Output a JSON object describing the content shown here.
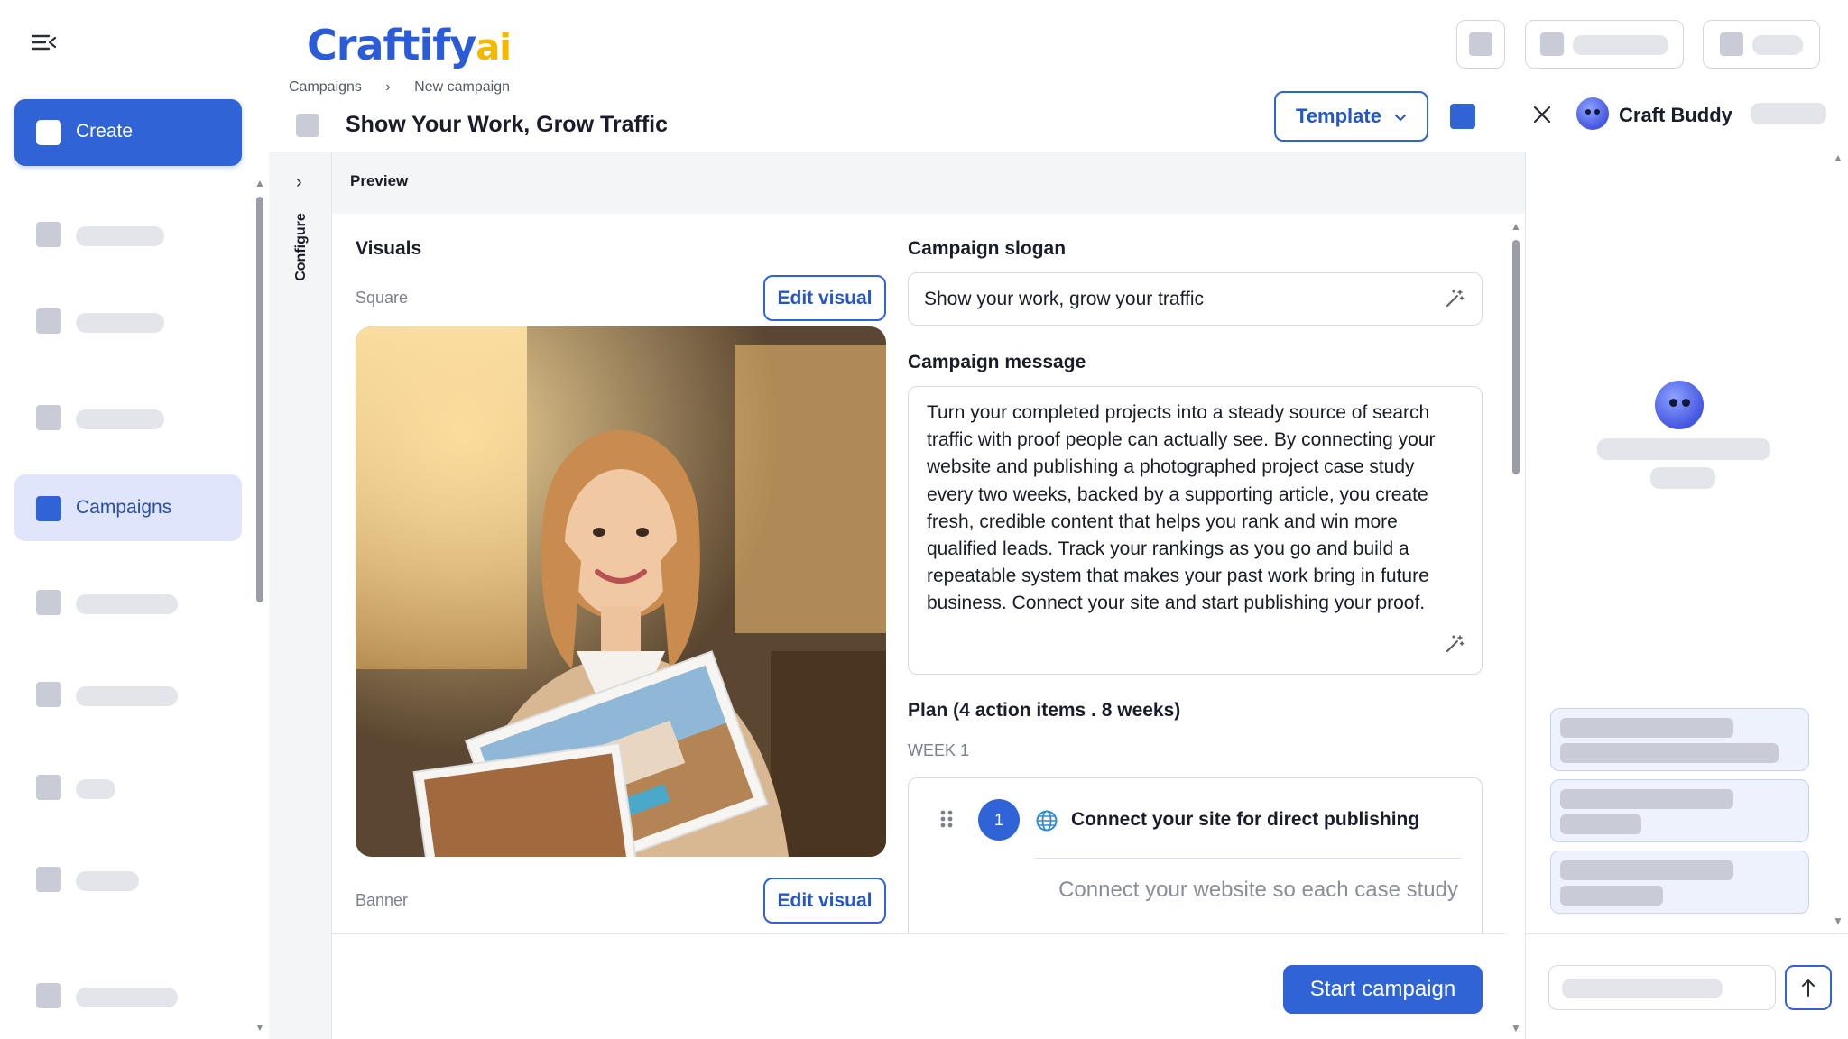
{
  "app": {
    "logo_main": "Craftify",
    "logo_ai": "ai"
  },
  "breadcrumb": {
    "root": "Campaigns",
    "current": "New campaign"
  },
  "page": {
    "title": "Show Your Work, Grow Traffic"
  },
  "sidebar": {
    "create_label": "Create",
    "campaigns_label": "Campaigns"
  },
  "toolbar": {
    "template_label": "Template"
  },
  "configure": {
    "label": "Configure"
  },
  "preview": {
    "title": "Preview",
    "visuals_title": "Visuals",
    "square_label": "Square",
    "banner_label": "Banner",
    "edit_visual_label": "Edit visual",
    "slogan_title": "Campaign slogan",
    "slogan_value": "Show your work, grow your traffic",
    "message_title": "Campaign message",
    "message_value": "Turn your completed projects into a steady source of search traffic with proof people can actually see. By connecting your website and publishing a photographed project case study every two weeks, backed by a supporting article, you create fresh, credible content that helps you rank and win more qualified leads. Track your rankings as you go and build a repeatable system that makes your past work bring in future business. Connect your site and start publishing your proof.",
    "plan_title": "Plan (4 action items . 8 weeks)",
    "week_label": "WEEK 1",
    "action_number": "1",
    "action_title": "Connect your site for direct publishing",
    "action_desc": "Connect your website so each case study",
    "start_label": "Start campaign"
  },
  "chat": {
    "title": "Craft Buddy"
  },
  "colors": {
    "accent": "#2f63d6",
    "logo_blue": "#2b5bd7",
    "logo_yellow": "#f5b800"
  }
}
